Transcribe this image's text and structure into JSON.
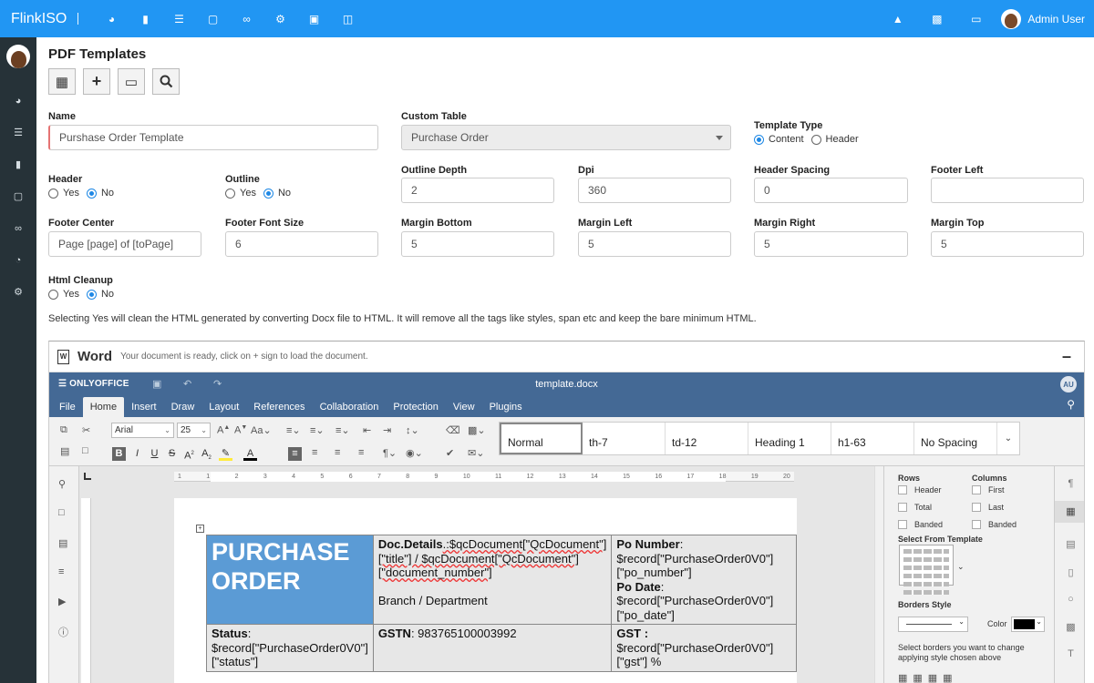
{
  "app": {
    "brand": "FlinkISO",
    "user_name": "Admin User"
  },
  "topnav": {
    "icons": [
      "dashboard-icon",
      "bookmark-icon",
      "list-icon",
      "folder-icon",
      "link-icon",
      "gears-icon",
      "document-icon",
      "database-icon"
    ],
    "right_icons": [
      "graduation-cap-icon",
      "bar-chart-icon",
      "credit-card-icon"
    ]
  },
  "sidebar": {
    "icons": [
      "dashboard-icon",
      "list-icon",
      "bookmark-icon",
      "folder-icon",
      "link-icon",
      "pie-chart-icon",
      "gear-icon"
    ]
  },
  "page": {
    "title": "PDF Templates"
  },
  "form": {
    "name": {
      "label": "Name",
      "value": "Purshase Order Template"
    },
    "custom_table": {
      "label": "Custom Table",
      "value": "Purchase Order"
    },
    "template_type": {
      "label": "Template Type",
      "options": [
        "Content",
        "Header"
      ],
      "selected": "Content"
    },
    "header": {
      "label": "Header",
      "options": [
        "Yes",
        "No"
      ],
      "selected": "No"
    },
    "outline": {
      "label": "Outline",
      "options": [
        "Yes",
        "No"
      ],
      "selected": "No"
    },
    "outline_depth": {
      "label": "Outline Depth",
      "value": "2"
    },
    "dpi": {
      "label": "Dpi",
      "value": "360"
    },
    "header_spacing": {
      "label": "Header Spacing",
      "value": "0"
    },
    "footer_left": {
      "label": "Footer Left",
      "value": ""
    },
    "footer_center": {
      "label": "Footer Center",
      "value": "Page [page] of [toPage]"
    },
    "footer_font_size": {
      "label": "Footer Font Size",
      "value": "6"
    },
    "margin_bottom": {
      "label": "Margin Bottom",
      "value": "5"
    },
    "margin_left": {
      "label": "Margin Left",
      "value": "5"
    },
    "margin_right": {
      "label": "Margin Right",
      "value": "5"
    },
    "margin_top": {
      "label": "Margin Top",
      "value": "5"
    },
    "html_cleanup": {
      "label": "Html Cleanup",
      "options": [
        "Yes",
        "No"
      ],
      "selected": "No"
    },
    "help_text": "Selecting Yes will clean the HTML generated by converting Docx file to HTML. It will remove all the tags like styles, span etc and keep the bare minimum HTML."
  },
  "word": {
    "title": "Word",
    "subtitle": "Your document is ready, click on + sign to load the document.",
    "editor": {
      "logo": "ONLYOFFICE",
      "filename": "template.docx",
      "user_initials": "AU",
      "tabs": [
        "File",
        "Home",
        "Insert",
        "Draw",
        "Layout",
        "References",
        "Collaboration",
        "Protection",
        "View",
        "Plugins"
      ],
      "active_tab": "Home",
      "font_name": "Arial",
      "font_size": "25",
      "styles": [
        "Normal",
        "th-7",
        "td-12",
        "Heading 1",
        "h1-63",
        "No Spacing"
      ],
      "ruler": [
        "1",
        "1",
        "2",
        "3",
        "4",
        "5",
        "6",
        "7",
        "8",
        "9",
        "10",
        "11",
        "12",
        "13",
        "14",
        "15",
        "16",
        "17",
        "18",
        "19",
        "20"
      ],
      "table": {
        "title": "PURCHASE ORDER",
        "doc_details_label": "Doc.Details",
        "doc_details_value": ".:$qcDocument[\"QcDocument\"][\"title\"] / $qcDocument[\"QcDocument\"][\"document_number\"]",
        "branch": "Branch / Department",
        "po_number_label": "Po Number",
        "po_number_value": ":\n$record[\"PurchaseOrder0V0\"][\"po_number\"]",
        "po_date_label": "Po Date",
        "po_date_value": ":\n$record[\"PurchaseOrder0V0\"][\"po_date\"]",
        "status_label": "Status",
        "status_value": ":\n$record[\"PurchaseOrder0V0\"][\"status\"]",
        "gstn_label": "GSTN",
        "gstn_value": ": 983765100003992",
        "gst_label": "GST :",
        "gst_value": "$record[\"PurchaseOrder0V0\"][\"gst\"] %"
      },
      "right_panel": {
        "rows_label": "Rows",
        "columns_label": "Columns",
        "rows_options": [
          "Header",
          "Total",
          "Banded"
        ],
        "columns_options": [
          "First",
          "Last",
          "Banded"
        ],
        "template_label": "Select From Template",
        "borders_label": "Borders Style",
        "color_label": "Color",
        "border_color": "#000000",
        "borders_help": "Select borders you want to change applying style chosen above"
      }
    }
  }
}
